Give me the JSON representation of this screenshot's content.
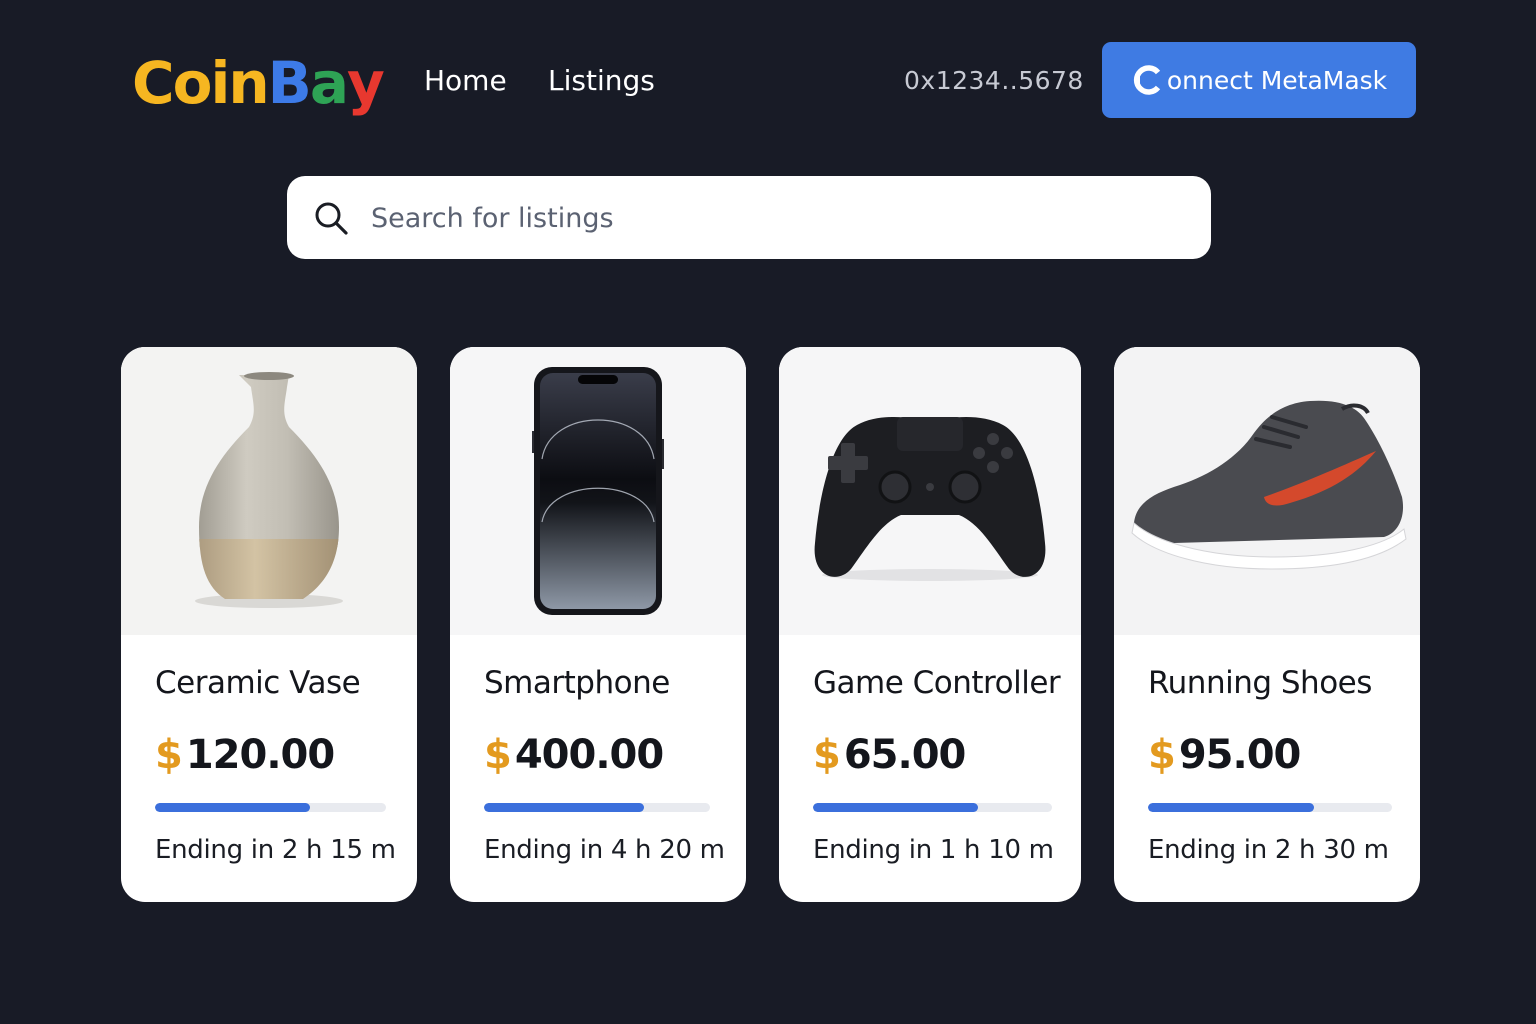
{
  "header": {
    "logo_letters": [
      {
        "char": "C",
        "color": "#f6b621"
      },
      {
        "char": "o",
        "color": "#f6b621"
      },
      {
        "char": "i",
        "color": "#f6b621"
      },
      {
        "char": "n",
        "color": "#f6b621"
      },
      {
        "char": "B",
        "color": "#3d7be8"
      },
      {
        "char": "a",
        "color": "#2ea355"
      },
      {
        "char": "y",
        "color": "#e8382f"
      }
    ],
    "nav": [
      {
        "label": "Home"
      },
      {
        "label": "Listings"
      }
    ],
    "wallet_address": "0x1234..5678",
    "connect_label": "onnect MetaMask",
    "connect_icon": "metamask-c-icon",
    "connect_color": "#3f7be3"
  },
  "search": {
    "placeholder": "Search for listings",
    "value": "",
    "icon": "search-icon"
  },
  "colors": {
    "background": "#181b26",
    "price_symbol": "#e39a1f",
    "progress_fill": "#3b6fdc",
    "progress_track": "#e8eaef"
  },
  "listings": [
    {
      "title": "Ceramic Vase",
      "currency": "$",
      "price": "120.00",
      "progress": 0.67,
      "ending": "Ending in 2 h 15 m",
      "image": "ceramic-vase"
    },
    {
      "title": "Smartphone",
      "currency": "$",
      "price": "400.00",
      "progress": 0.71,
      "ending": "Ending in 4 h 20 m",
      "image": "smartphone"
    },
    {
      "title": "Game Controller",
      "currency": "$",
      "price": "65.00",
      "progress": 0.69,
      "ending": "Ending in 1 h 10 m",
      "image": "game-controller"
    },
    {
      "title": "Running Shoes",
      "currency": "$",
      "price": "95.00",
      "progress": 0.68,
      "ending": "Ending in 2 h 30 m",
      "image": "running-shoe"
    }
  ]
}
